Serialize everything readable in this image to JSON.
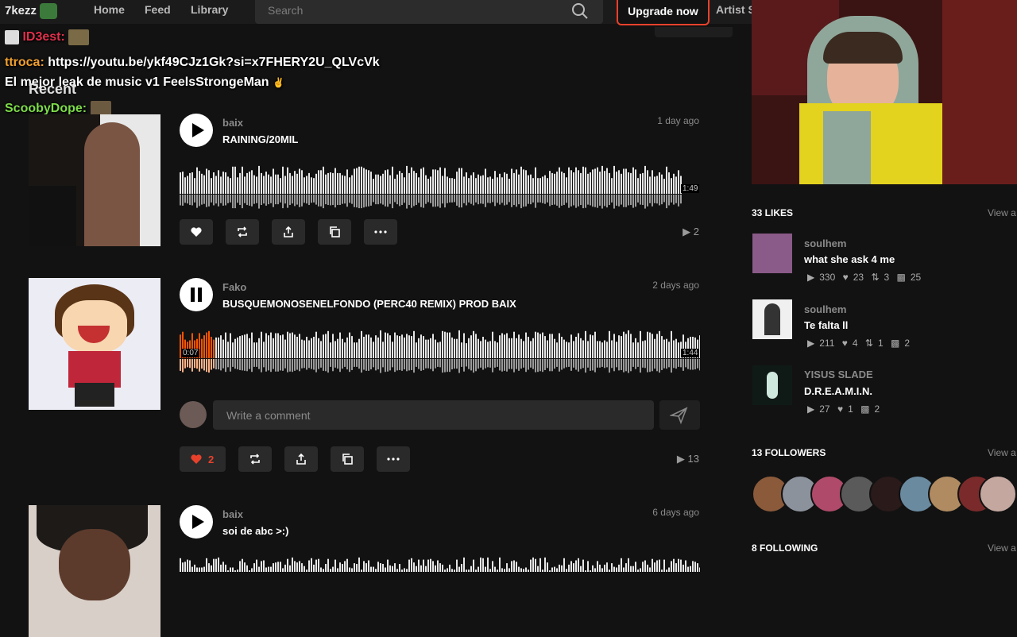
{
  "nav": {
    "logo": "7kezz",
    "home": "Home",
    "feed": "Feed",
    "library": "Library",
    "search_placeholder": "Search",
    "upgrade": "Upgrade now",
    "artist": "Artist S"
  },
  "chat": [
    {
      "user": "ID3est:",
      "text": "",
      "color": "#e0304b"
    },
    {
      "user": "ttroca:",
      "text": "https://youtu.be/ykf49CJz1Gk?si=x7FHERY2U_QLVcVk",
      "color": "#f0a030"
    },
    {
      "user": "",
      "text": "El mejor leak de music v1 FeelsStrongeMan",
      "color": "#ffffff"
    },
    {
      "user": "ScoobyDope:",
      "text": "",
      "color": "#7ddc4a"
    }
  ],
  "section_recent": "Recent",
  "tracks": [
    {
      "artist": "baix",
      "title": "RAINING/20MIL",
      "ago": "1 day ago",
      "duration": "1:49",
      "plays": "2",
      "playing": false
    },
    {
      "artist": "Fako",
      "title": "BUSQUEMONOSENELFONDO (PERC40 REMIX) PROD BAIX",
      "ago": "2 days ago",
      "elapsed": "0:07",
      "duration": "1:44",
      "likes": "2",
      "plays": "13",
      "playing": true,
      "comment_placeholder": "Write a comment"
    },
    {
      "artist": "baix",
      "title": "soi de abc >:)",
      "ago": "6 days ago"
    }
  ],
  "sidebar": {
    "likes_header": "33 LIKES",
    "view_all": "View a",
    "likes": [
      {
        "user": "soulhem",
        "title": "what she ask 4 me",
        "plays": "330",
        "likes": "23",
        "reposts": "3",
        "comments": "25"
      },
      {
        "user": "soulhem",
        "title": "Te falta ll",
        "plays": "211",
        "likes": "4",
        "reposts": "1",
        "comments": "2"
      },
      {
        "user": "YISUS SLADE",
        "title": "D.R.E.A.M.I.N.",
        "plays": "27",
        "likes": "1",
        "comments": "2"
      }
    ],
    "followers_header": "13 FOLLOWERS",
    "following_header": "8 FOLLOWING"
  },
  "colors": {
    "accent": "#e8412b",
    "progress": "#ff5500"
  }
}
